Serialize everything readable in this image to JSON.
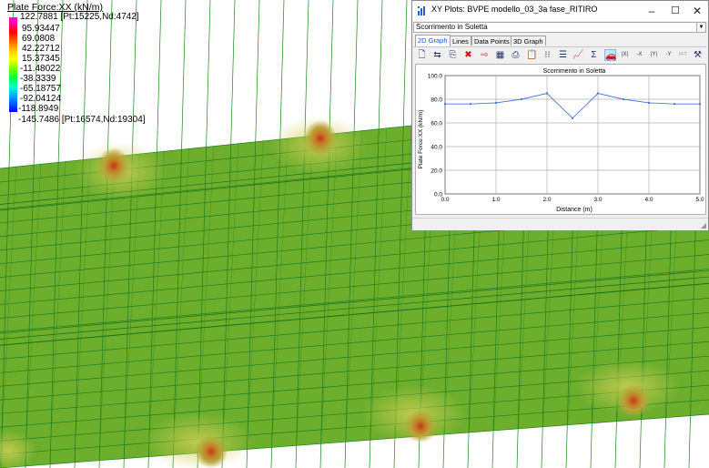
{
  "legend": {
    "title": "Plate Force:XX  (kN/m)",
    "max_label": "122.7881 [Pt:15225,Nd:4742]",
    "values": [
      "95.93447",
      "69.0808",
      "42.22712",
      "15.37345",
      "-11.48022",
      "-38.3339",
      "-65.18757",
      "-92.04124",
      "-118.8949"
    ],
    "min_label": "-145.7486 [Pt:16574,Nd:19304]"
  },
  "window": {
    "title": "XY Plots: BVPE modello_03_3a fase_RITIRO",
    "minimize": "–",
    "maximize": "☐",
    "close": "✕",
    "selector_value": "Scorrimento in Soletta",
    "tabs": [
      "2D Graph",
      "Lines",
      "Data Points",
      "3D Graph"
    ],
    "toolbar_icons": [
      "new-icon",
      "transfer-icon",
      "copy-icon",
      "delete-icon",
      "export-icon",
      "table-icon",
      "preview-icon",
      "paste-icon",
      "grid-icon",
      "list-icon",
      "chart-icon",
      "sigma-icon",
      "car-icon",
      "abs-x-icon",
      "abs-y-icon",
      "neg-y-icon",
      "fft-icon",
      "tool-icon"
    ],
    "toolbar_labels": {
      "abs_x": "|X|",
      "neg_x": "-X",
      "abs_y": "|Y|",
      "neg_y": "-Y",
      "fft": "FFT"
    }
  },
  "chart_data": {
    "type": "line",
    "title": "Scorrimento in Soletta",
    "xlabel": "Distance (m)",
    "ylabel": "Plate Force:XX (kN/m)",
    "xlim": [
      0,
      5
    ],
    "ylim": [
      0,
      100
    ],
    "xticks": [
      "0.0",
      "1.0",
      "2.0",
      "3.0",
      "4.0",
      "5.0"
    ],
    "yticks": [
      "0.0",
      "20.0",
      "40.0",
      "60.0",
      "80.0",
      "100.0"
    ],
    "grid": true,
    "series": [
      {
        "color": "#4a78d6",
        "x": [
          0.0,
          0.5,
          1.0,
          1.5,
          2.0,
          2.5,
          3.0,
          3.5,
          4.0,
          4.5,
          5.0
        ],
        "y": [
          76,
          76,
          77,
          80,
          85,
          64,
          85,
          80,
          77,
          76,
          76
        ]
      }
    ]
  }
}
